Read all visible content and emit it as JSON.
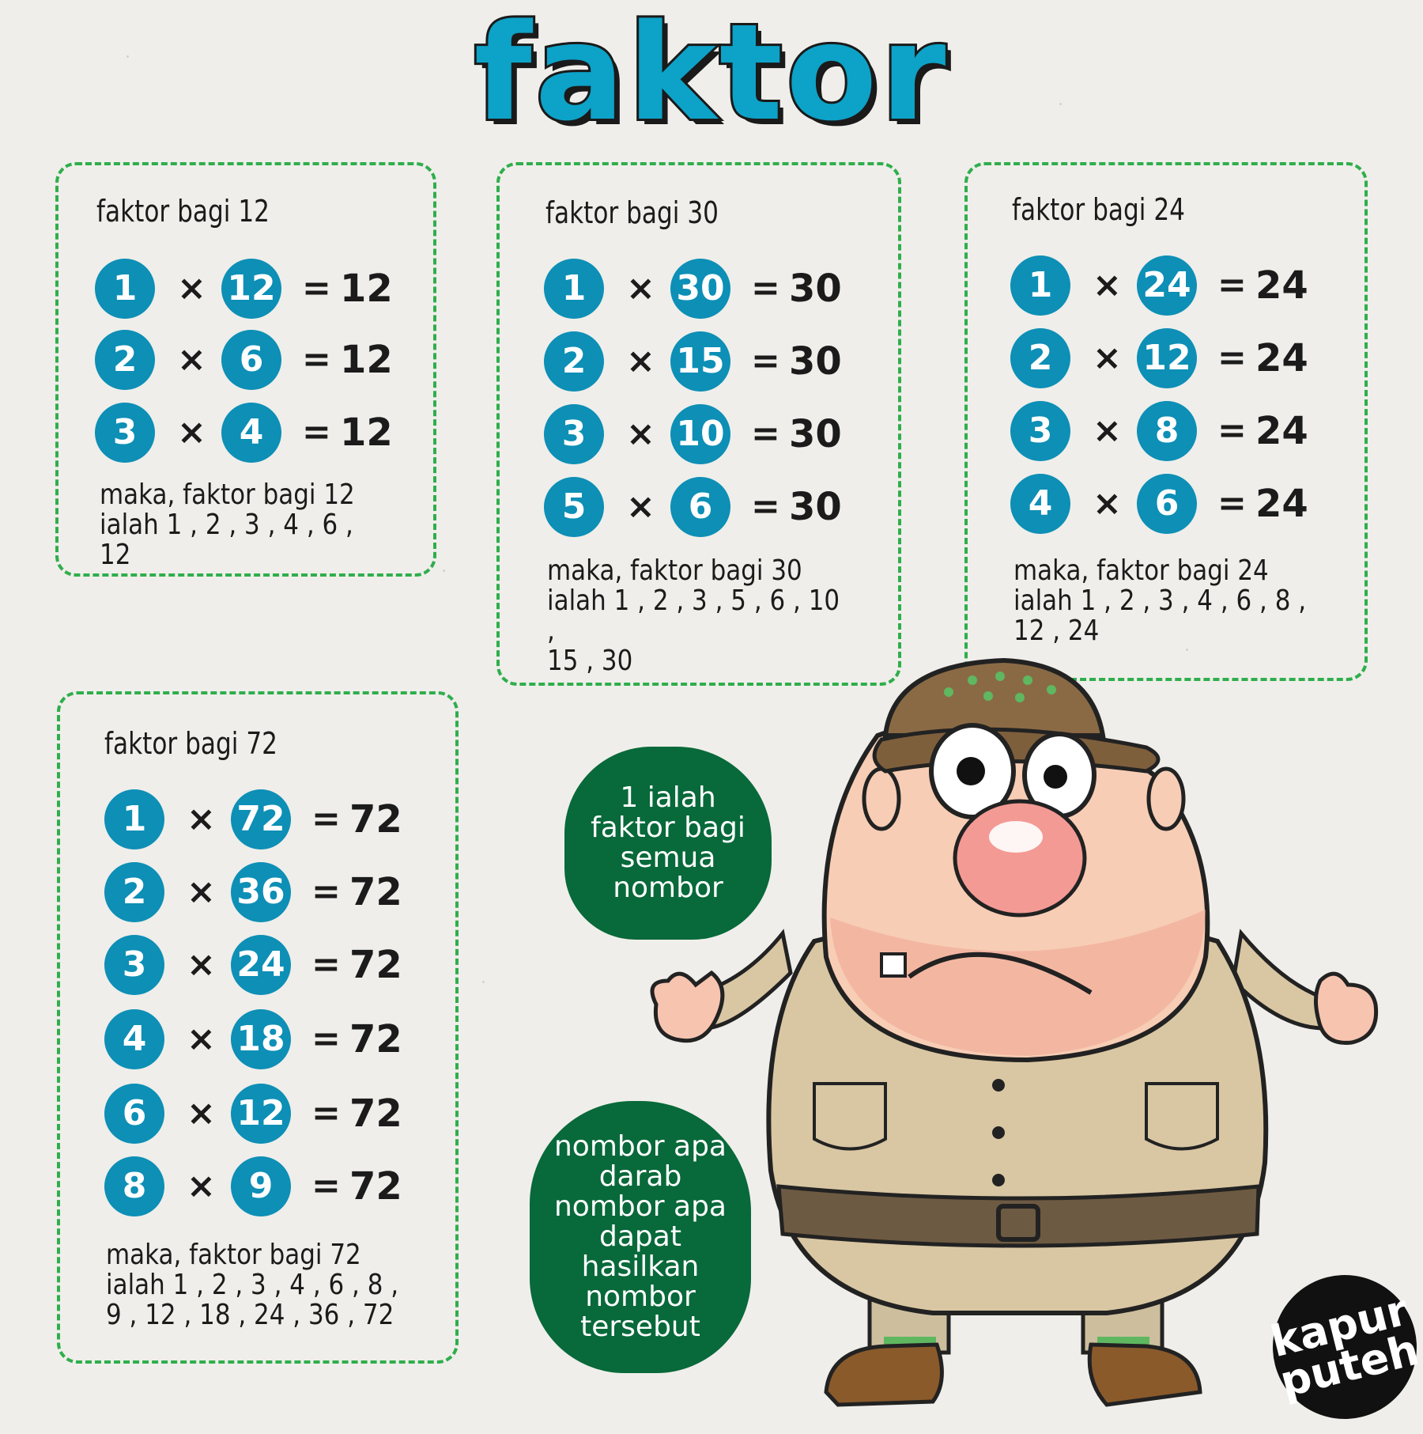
{
  "title": "faktor",
  "cards": [
    {
      "heading": "faktor bagi 12",
      "rows": [
        {
          "a": "1",
          "b": "12",
          "result": "12"
        },
        {
          "a": "2",
          "b": "6",
          "result": "12"
        },
        {
          "a": "3",
          "b": "4",
          "result": "12"
        }
      ],
      "summary_line1": "maka, faktor bagi 12",
      "summary_line2": "ialah 1 , 2 , 3 , 4 , 6 , 12",
      "summary_line3": ""
    },
    {
      "heading": "faktor bagi 30",
      "rows": [
        {
          "a": "1",
          "b": "30",
          "result": "30"
        },
        {
          "a": "2",
          "b": "15",
          "result": "30"
        },
        {
          "a": "3",
          "b": "10",
          "result": "30"
        },
        {
          "a": "5",
          "b": "6",
          "result": "30"
        }
      ],
      "summary_line1": "maka, faktor bagi 30",
      "summary_line2": "ialah 1 , 2 , 3 , 5 , 6 , 10 ,",
      "summary_line3": "15 , 30"
    },
    {
      "heading": "faktor bagi 24",
      "rows": [
        {
          "a": "1",
          "b": "24",
          "result": "24"
        },
        {
          "a": "2",
          "b": "12",
          "result": "24"
        },
        {
          "a": "3",
          "b": "8",
          "result": "24"
        },
        {
          "a": "4",
          "b": "6",
          "result": "24"
        }
      ],
      "summary_line1": "maka, faktor bagi 24",
      "summary_line2": "ialah 1 , 2 , 3 , 4 , 6 , 8 ,",
      "summary_line3": "12 , 24"
    },
    {
      "heading": "faktor bagi 72",
      "rows": [
        {
          "a": "1",
          "b": "72",
          "result": "72"
        },
        {
          "a": "2",
          "b": "36",
          "result": "72"
        },
        {
          "a": "3",
          "b": "24",
          "result": "72"
        },
        {
          "a": "4",
          "b": "18",
          "result": "72"
        },
        {
          "a": "6",
          "b": "12",
          "result": "72"
        },
        {
          "a": "8",
          "b": "9",
          "result": "72"
        }
      ],
      "summary_line1": "maka, faktor bagi 72",
      "summary_line2": "ialah 1 , 2 , 3 , 4 , 6 , 8 ,",
      "summary_line3": "9 , 12 , 18 , 24 , 36 , 72"
    }
  ],
  "symbols": {
    "times": "×",
    "equals": "="
  },
  "bubble_top": "1 ialah faktor bagi semua nombor",
  "bubble_bottom": "nombor apa darab nombor apa dapat hasilkan nombor tersebut",
  "logo_line1": "kapur",
  "logo_line2": "puteh",
  "colors": {
    "title": "#0da2c7",
    "circle": "#0d8fb6",
    "dash": "#2fae4c",
    "bubble": "#08693a"
  }
}
